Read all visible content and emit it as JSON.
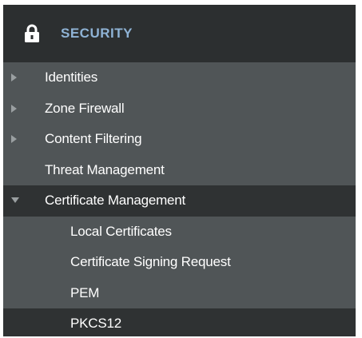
{
  "header": {
    "title": "SECURITY",
    "icon": "lock-icon"
  },
  "colors": {
    "header_text": "#8fb3d5",
    "panel_dark": "#2f3233",
    "panel_light": "#505557"
  },
  "menu": {
    "identities": "Identities",
    "zone_firewall": "Zone Firewall",
    "content_filtering": "Content Filtering",
    "threat_management": "Threat Management",
    "certificate_management": "Certificate Management",
    "local_certificates": "Local Certificates",
    "certificate_signing_request": "Certificate Signing Request",
    "pem": "PEM",
    "pkcs12": "PKCS12"
  }
}
